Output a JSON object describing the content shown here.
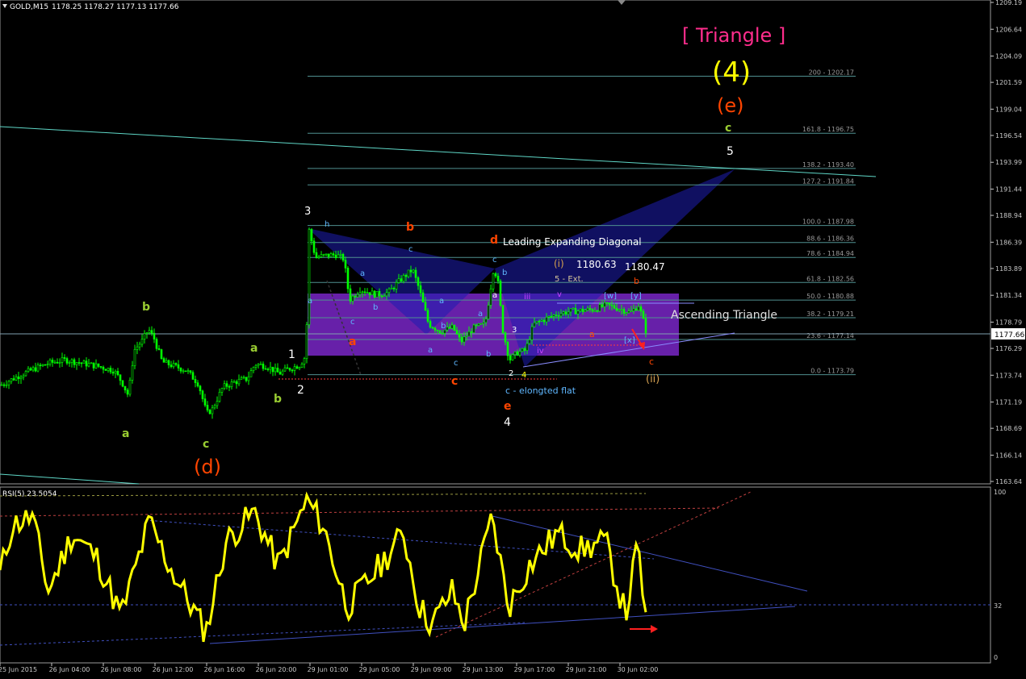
{
  "header": {
    "symbol": "GOLD,M15",
    "ohlc": "1178.25 1178.27 1177.13 1177.66",
    "current_price": "1177.66"
  },
  "price_axis": {
    "ticks": [
      "1209.19",
      "1206.64",
      "1204.09",
      "1201.59",
      "1199.04",
      "1196.54",
      "1193.99",
      "1191.44",
      "1188.94",
      "1186.39",
      "1183.89",
      "1181.34",
      "1178.79",
      "1176.29",
      "1173.74",
      "1171.19",
      "1168.69",
      "1166.14",
      "1163.64"
    ]
  },
  "time_axis": {
    "labels": [
      "25 Jun 2015",
      "26 Jun 04:00",
      "26 Jun 08:00",
      "26 Jun 12:00",
      "26 Jun 16:00",
      "26 Jun 20:00",
      "29 Jun 01:00",
      "29 Jun 05:00",
      "29 Jun 09:00",
      "29 Jun 13:00",
      "29 Jun 17:00",
      "29 Jun 21:00",
      "30 Jun 02:00"
    ]
  },
  "fib_levels": [
    {
      "label": "200 - 1202.17"
    },
    {
      "label": "161.8 - 1196.75"
    },
    {
      "label": "138.2 - 1193.40"
    },
    {
      "label": "127.2 - 1191.84"
    },
    {
      "label": "100.0 - 1187.98"
    },
    {
      "label": "88.6 - 1186.36"
    },
    {
      "label": "78.6 - 1184.94"
    },
    {
      "label": "61.8 - 1182.56"
    },
    {
      "label": "50.0 - 1180.88"
    },
    {
      "label": "38.2 - 1179.21"
    },
    {
      "label": "23.6 - 1177.14"
    },
    {
      "label": "0.0 - 1173.79"
    }
  ],
  "annotations": {
    "triangle_title": "[ Triangle ]",
    "wave_4_big": "(4)",
    "wave_e_big": "(e)",
    "wave_d_big": "(d)",
    "leading_diagonal": "Leading Expanding Diagonal",
    "ascending_triangle": "Ascending Triangle",
    "elongated_flat": "c - elongted flat",
    "five_ext": "5 - Ext.",
    "price_1": "1180.63",
    "price_2": "1180.47",
    "wave_i": "(i)",
    "wave_ii": "(ii)"
  },
  "rsi": {
    "label": "RSI(5) 23.5054",
    "ticks": [
      "100",
      "32",
      "0"
    ]
  },
  "colors": {
    "background": "#000000",
    "candle": "#00ff00",
    "rsi_line": "#ffff00",
    "triangle_text": "#ff2d8c",
    "wave_orange": "#ff4500",
    "wave_green": "#9acd32",
    "wave_yellow": "#ffff00",
    "fib_line": "#4f8f8f",
    "purple_box": "#8a2be2",
    "harmonic": "#2a2ab0"
  },
  "chart_data": {
    "type": "candlestick",
    "title": "GOLD,M15",
    "ylim": [
      1163.64,
      1209.19
    ],
    "close_path": [
      [
        0,
        1172.8
      ],
      [
        20,
        1173.6
      ],
      [
        40,
        1174.3
      ],
      [
        60,
        1174.9
      ],
      [
        80,
        1175.2
      ],
      [
        100,
        1174.9
      ],
      [
        120,
        1174.6
      ],
      [
        140,
        1174.2
      ],
      [
        150,
        1173.1
      ],
      [
        158,
        1171.8
      ],
      [
        165,
        1176.1
      ],
      [
        175,
        1177.0
      ],
      [
        183,
        1178.1
      ],
      [
        190,
        1177.2
      ],
      [
        200,
        1175.0
      ],
      [
        215,
        1174.6
      ],
      [
        230,
        1174.2
      ],
      [
        245,
        1172.9
      ],
      [
        255,
        1170.1
      ],
      [
        262,
        1170.5
      ],
      [
        275,
        1172.6
      ],
      [
        290,
        1173.1
      ],
      [
        305,
        1173.4
      ],
      [
        315,
        1174.8
      ],
      [
        330,
        1174.6
      ],
      [
        345,
        1173.9
      ],
      [
        355,
        1174.3
      ],
      [
        370,
        1174.7
      ],
      [
        378,
        1175.6
      ],
      [
        382,
        1187.5
      ],
      [
        390,
        1184.9
      ],
      [
        400,
        1185.1
      ],
      [
        415,
        1185.2
      ],
      [
        425,
        1184.8
      ],
      [
        432,
        1180.9
      ],
      [
        445,
        1181.9
      ],
      [
        465,
        1181.4
      ],
      [
        480,
        1181.6
      ],
      [
        495,
        1182.8
      ],
      [
        510,
        1183.8
      ],
      [
        518,
        1182.0
      ],
      [
        530,
        1178.6
      ],
      [
        545,
        1177.9
      ],
      [
        560,
        1178.3
      ],
      [
        570,
        1176.9
      ],
      [
        585,
        1178.2
      ],
      [
        600,
        1178.6
      ],
      [
        610,
        1183.7
      ],
      [
        615,
        1183.2
      ],
      [
        622,
        1178.0
      ],
      [
        630,
        1175.2
      ],
      [
        640,
        1175.9
      ],
      [
        650,
        1176.1
      ],
      [
        660,
        1178.6
      ],
      [
        675,
        1179.1
      ],
      [
        690,
        1179.6
      ],
      [
        705,
        1179.8
      ],
      [
        720,
        1179.9
      ],
      [
        735,
        1180.0
      ],
      [
        750,
        1180.4
      ],
      [
        765,
        1180.1
      ],
      [
        780,
        1179.7
      ],
      [
        790,
        1180.4
      ],
      [
        795,
        1179.2
      ],
      [
        800,
        1177.7
      ]
    ]
  }
}
